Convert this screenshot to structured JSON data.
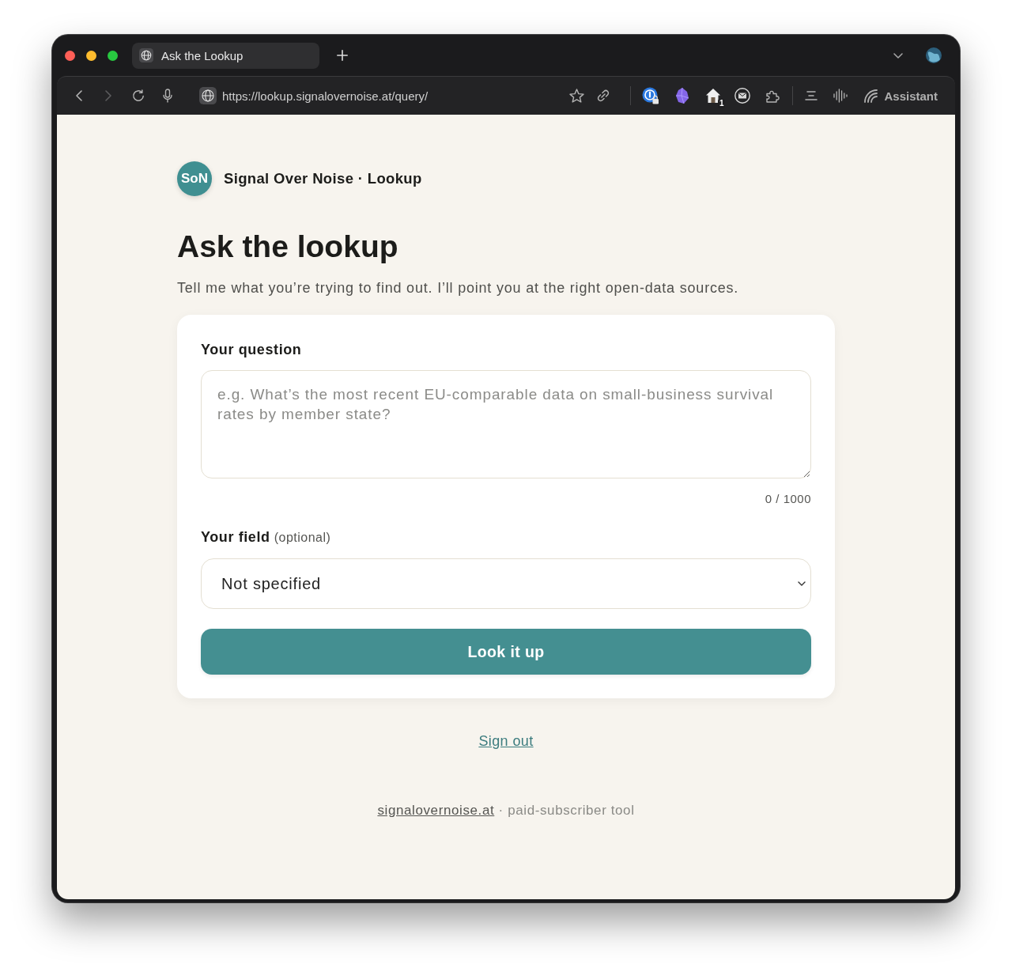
{
  "browser": {
    "tabs": [
      {
        "title": "Ask the Lookup",
        "selected": true
      }
    ],
    "nav_buttons": [
      {
        "kind": "back",
        "disabled": false
      },
      {
        "kind": "forward",
        "disabled": true
      }
    ],
    "url": "https://lookup.signalovernoise.at/query/",
    "extension_badge": "1",
    "assistant_label": "Assistant"
  },
  "header": {
    "logo": "SoN",
    "site_title": "Signal Over Noise · Lookup"
  },
  "page": {
    "title": "Ask the lookup",
    "subtitle": "Tell me what you’re trying to find out. I’ll point you at the right open-data sources."
  },
  "form": {
    "question": {
      "label": "Your question",
      "placeholder": "e.g. What’s the most recent EU-comparable data on small-business survival rates by member state?",
      "counter": "0 / 1000"
    },
    "field": {
      "label": "Your field",
      "hint": "(optional)",
      "value": "Not specified"
    },
    "submit": "Look it up"
  },
  "sign_out": "Sign out",
  "footer": {
    "link": "signalovernoise.at",
    "text": "· paid-subscriber tool"
  }
}
